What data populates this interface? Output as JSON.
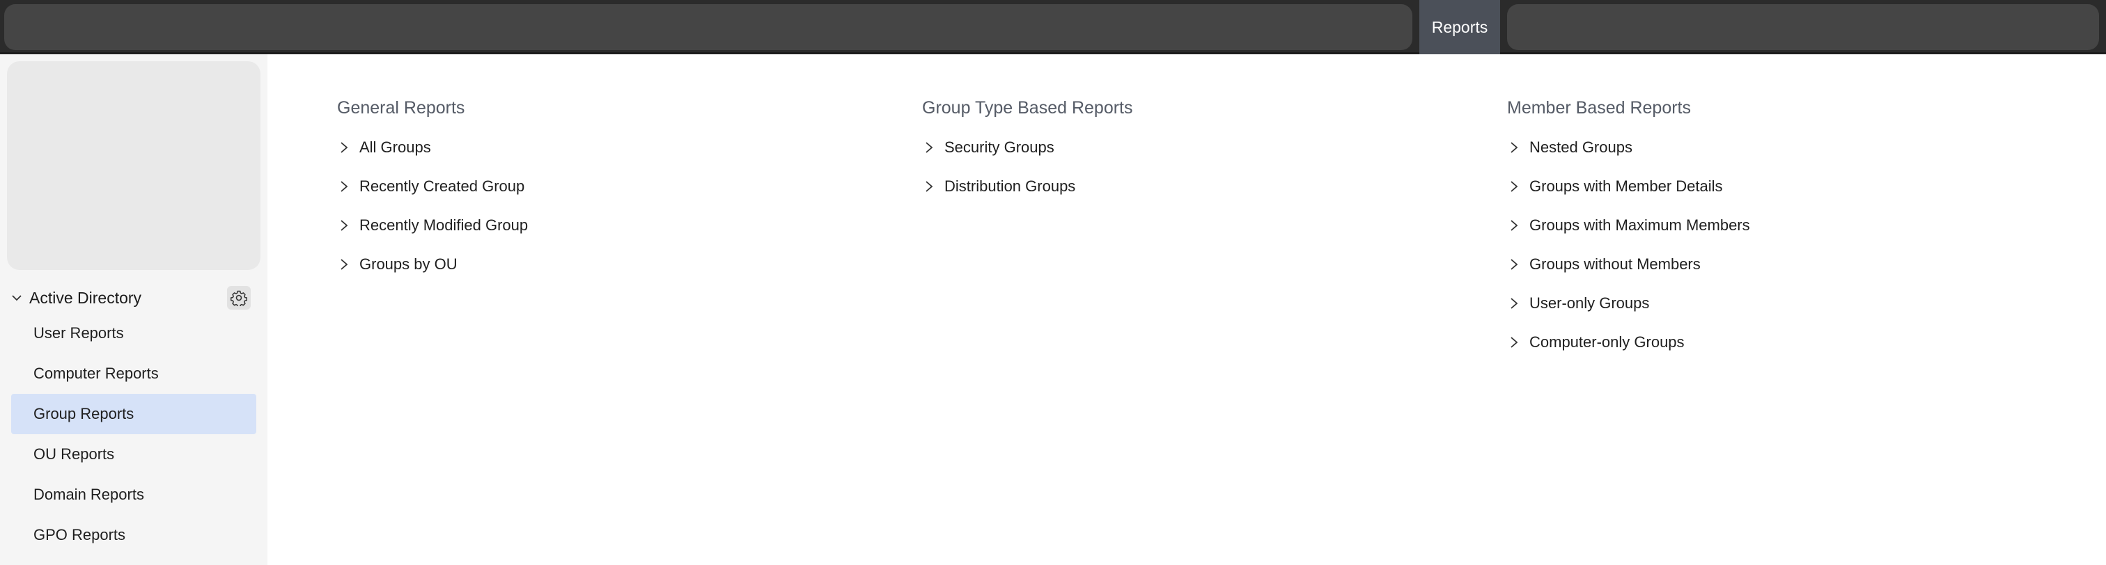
{
  "topbar": {
    "active_tab": "Reports"
  },
  "sidebar": {
    "section": "Active Directory",
    "items": [
      {
        "label": "User Reports",
        "active": false
      },
      {
        "label": "Computer Reports",
        "active": false
      },
      {
        "label": "Group Reports",
        "active": true
      },
      {
        "label": "OU Reports",
        "active": false
      },
      {
        "label": "Domain Reports",
        "active": false
      },
      {
        "label": "GPO Reports",
        "active": false
      }
    ]
  },
  "columns": [
    {
      "title": "General Reports",
      "items": [
        "All Groups",
        "Recently Created Group",
        "Recently Modified Group",
        "Groups by OU"
      ]
    },
    {
      "title": "Group Type Based Reports",
      "items": [
        "Security Groups",
        "Distribution Groups"
      ]
    },
    {
      "title": "Member Based Reports",
      "items": [
        "Nested Groups",
        "Groups with Member Details",
        "Groups with Maximum Members",
        "Groups without Members",
        "User-only Groups",
        "Computer-only Groups"
      ]
    }
  ],
  "colors": {
    "topbar_bg": "#2b2b2b",
    "tab_active_bg": "#4b5059",
    "sidebar_bg": "#f5f5f5",
    "nav_active_bg": "#d6e2f8",
    "column_title": "#555b66"
  }
}
